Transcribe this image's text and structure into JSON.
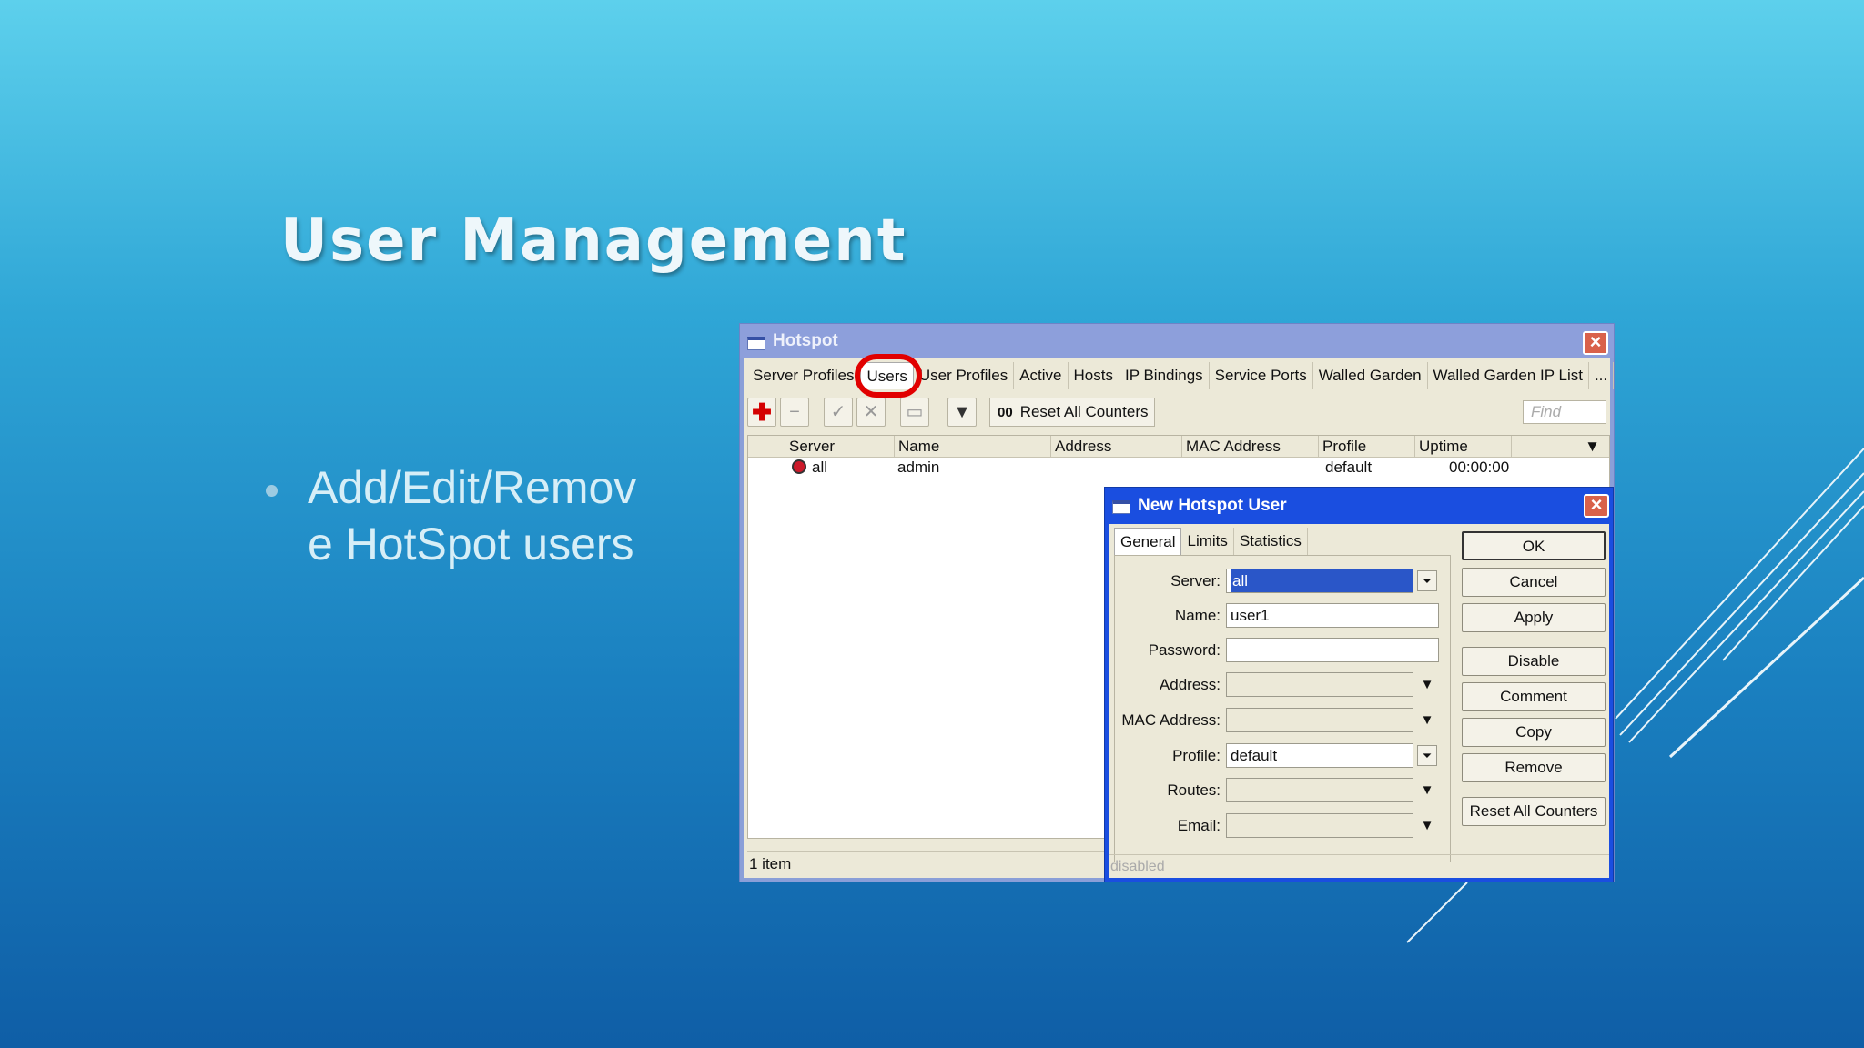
{
  "slide": {
    "title": "User Management",
    "bullet": "Add/Edit/Remov e HotSpot users"
  },
  "window": {
    "title": "Hotspot",
    "tabs": [
      "Server Profiles",
      "Users",
      "User Profiles",
      "Active",
      "Hosts",
      "IP Bindings",
      "Service Ports",
      "Walled Garden",
      "Walled Garden IP List",
      "..."
    ],
    "active_tab": "Users",
    "toolbar": {
      "reset_prefix": "00",
      "reset_label": "Reset All Counters",
      "find_placeholder": "Find"
    },
    "columns": [
      "Server",
      "Name",
      "Address",
      "MAC Address",
      "Profile",
      "Uptime"
    ],
    "rows": [
      {
        "server": "all",
        "name": "admin",
        "address": "",
        "mac": "",
        "profile": "default",
        "uptime": "00:00:00"
      }
    ],
    "status": "1 item"
  },
  "dialog": {
    "title": "New Hotspot User",
    "tabs": [
      "General",
      "Limits",
      "Statistics"
    ],
    "fields": {
      "server_label": "Server:",
      "server_value": "all",
      "name_label": "Name:",
      "name_value": "user1",
      "password_label": "Password:",
      "password_value": "",
      "address_label": "Address:",
      "mac_label": "MAC Address:",
      "profile_label": "Profile:",
      "profile_value": "default",
      "routes_label": "Routes:",
      "email_label": "Email:"
    },
    "buttons": [
      "OK",
      "Cancel",
      "Apply",
      "Disable",
      "Comment",
      "Copy",
      "Remove",
      "Reset All Counters"
    ],
    "status": "disabled"
  },
  "colors": {
    "highlight": "#e10000",
    "dialog_title": "#1a4ee0",
    "window_title": "#8d9fdb"
  }
}
